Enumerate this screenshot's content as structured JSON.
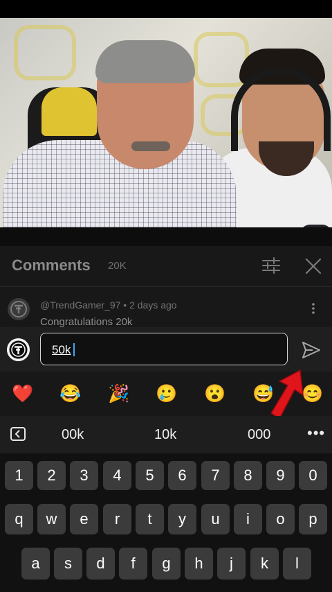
{
  "comments": {
    "title": "Comments",
    "count": "20K",
    "top_comment": {
      "author": "@TrendGamer_97 • 2 days ago",
      "text": "Congratulations 20k"
    }
  },
  "composer": {
    "value": "50k"
  },
  "emojis": [
    "❤️",
    "😂",
    "🎉",
    "🥲",
    "😮",
    "😅",
    "😊"
  ],
  "suggestions": [
    "00k",
    "10k",
    "000"
  ],
  "keyboard": {
    "row1": [
      "1",
      "2",
      "3",
      "4",
      "5",
      "6",
      "7",
      "8",
      "9",
      "0"
    ],
    "row2": [
      "q",
      "w",
      "e",
      "r",
      "t",
      "y",
      "u",
      "i",
      "o",
      "p"
    ],
    "row3": [
      "a",
      "s",
      "d",
      "f",
      "g",
      "h",
      "j",
      "k",
      "l"
    ]
  },
  "colors": {
    "caret": "#3ea6ff",
    "annotation_arrow": "#e0151c",
    "sheet_bg": "#181818"
  }
}
